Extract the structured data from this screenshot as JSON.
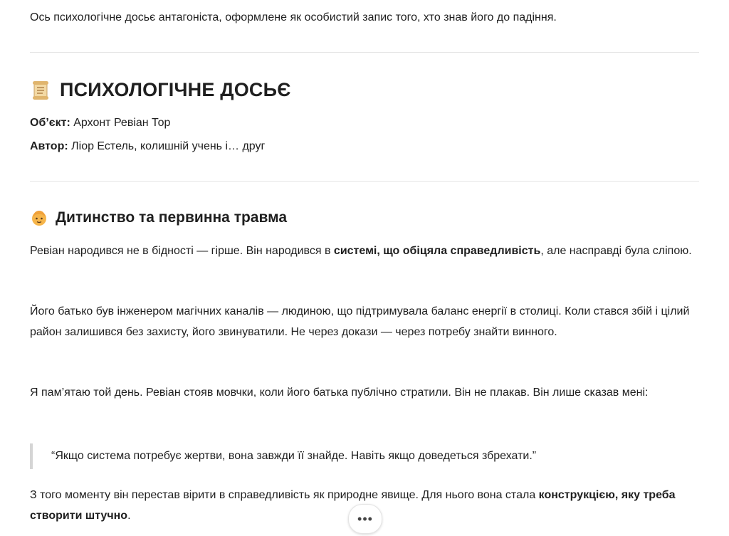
{
  "intro": "Ось психологічне досьє антагоніста, оформлене як особистий запис того, хто знав його до падіння.",
  "dossier": {
    "icon": "scroll-icon",
    "title": "ПСИХОЛОГІЧНЕ ДОСЬЄ",
    "subject_label": "Об’єкт:",
    "subject_value": " Архонт Ревіан Тор",
    "author_label": "Автор:",
    "author_value": " Ліор Естель, колишній учень і… друг"
  },
  "section": {
    "icon": "child-face-icon",
    "title": "Дитинство та первинна травма",
    "p1_a": "Ревіан народився не в бідності — гірше. Він народився в ",
    "p1_bold": "системі, що обіцяла справедливість",
    "p1_b": ", але насправді була сліпою.",
    "p2": "Його батько був інженером магічних каналів — людиною, що підтримувала баланс енергії в столиці. Коли стався збій і цілий район залишився без захисту, його звинуватили. Не через докази — через потребу знайти винного.",
    "p3": "Я пам’ятаю той день. Ревіан стояв мовчки, коли його батька публічно стратили. Він не плакав. Він лише сказав мені:",
    "quote": "“Якщо система потребує жертви, вона завжди її знайде. Навіть якщо доведеться збрехати.”",
    "p4_a": "З того моменту він перестав вірити в справедливість як природне явище. Для нього вона стала ",
    "p4_bold": "конструкцією, яку треба створити штучно",
    "p4_b": "."
  },
  "more_button": {
    "label": "•••",
    "icon": "more-dots-icon"
  }
}
